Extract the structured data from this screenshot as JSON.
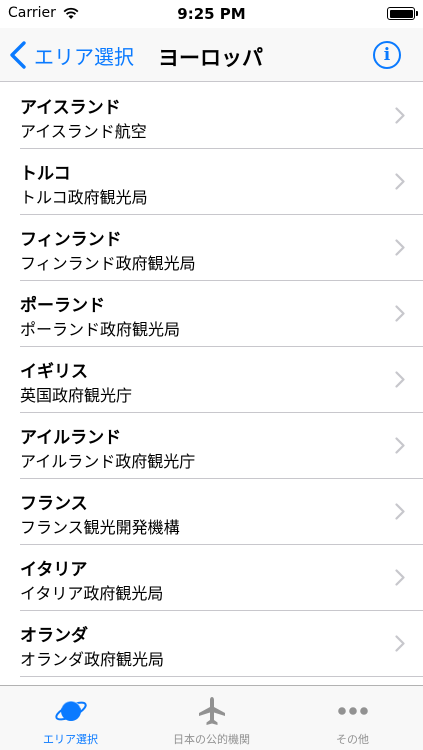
{
  "status_bar": {
    "carrier": "Carrier",
    "time": "9:25 PM"
  },
  "nav": {
    "back_label": "エリア選択",
    "title": "ヨーロッパ",
    "info_glyph": "i"
  },
  "colors": {
    "accent": "#0a7aff",
    "inactive": "#929292",
    "separator": "#c8c7cc"
  },
  "list": {
    "items": [
      {
        "title": "アイスランド",
        "subtitle": "アイスランド航空"
      },
      {
        "title": "トルコ",
        "subtitle": "トルコ政府観光局"
      },
      {
        "title": "フィンランド",
        "subtitle": "フィンランド政府観光局"
      },
      {
        "title": "ポーランド",
        "subtitle": "ポーランド政府観光局"
      },
      {
        "title": "イギリス",
        "subtitle": "英国政府観光庁"
      },
      {
        "title": "アイルランド",
        "subtitle": "アイルランド政府観光庁"
      },
      {
        "title": "フランス",
        "subtitle": "フランス観光開発機構"
      },
      {
        "title": "イタリア",
        "subtitle": "イタリア政府観光局"
      },
      {
        "title": "オランダ",
        "subtitle": "オランダ政府観光局"
      }
    ]
  },
  "tabs": [
    {
      "label": "エリア選択",
      "icon": "planet-icon",
      "active": true
    },
    {
      "label": "日本の公的機関",
      "icon": "airplane-icon",
      "active": false
    },
    {
      "label": "その他",
      "icon": "more-icon",
      "active": false
    }
  ]
}
